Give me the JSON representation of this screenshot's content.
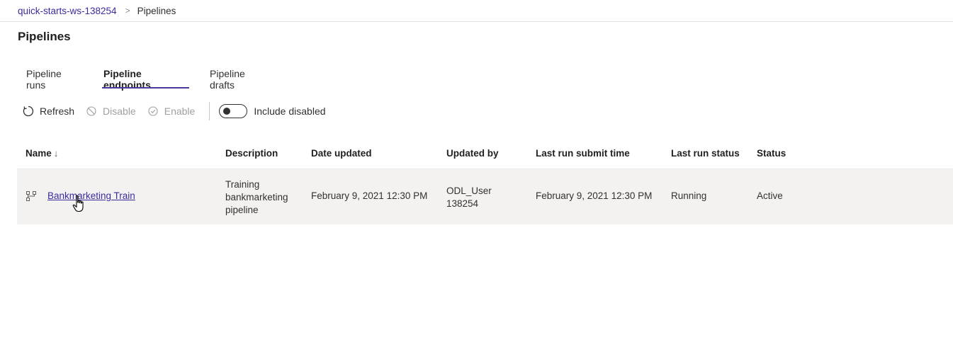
{
  "breadcrumb": {
    "workspace": "quick-starts-ws-138254",
    "separator": ">",
    "current": "Pipelines"
  },
  "page": {
    "title": "Pipelines"
  },
  "tabs": [
    {
      "label": "Pipeline runs",
      "selected": false
    },
    {
      "label": "Pipeline endpoints",
      "selected": true
    },
    {
      "label": "Pipeline drafts",
      "selected": false
    }
  ],
  "toolbar": {
    "refresh": "Refresh",
    "disable": "Disable",
    "enable": "Enable",
    "include_disabled": "Include disabled",
    "include_disabled_on": false
  },
  "table": {
    "columns": {
      "name": "Name",
      "name_sort": "↓",
      "description": "Description",
      "date_updated": "Date updated",
      "updated_by": "Updated by",
      "last_run_submit_time": "Last run submit time",
      "last_run_status": "Last run status",
      "status": "Status"
    },
    "rows": [
      {
        "name": "Bankmarketing Train",
        "description": "Training bankmarketing pipeline",
        "date_updated": "February 9, 2021 12:30 PM",
        "updated_by": "ODL_User 138254",
        "last_run_submit_time": "February 9, 2021 12:30 PM",
        "last_run_status": "Running",
        "status": "Active",
        "icon": "pipeline-icon"
      }
    ]
  },
  "colors": {
    "accent": "#4b3a9e",
    "link": "#3b2c9e",
    "row_background": "#f3f2f1",
    "disabled_text": "#a19f9d"
  }
}
